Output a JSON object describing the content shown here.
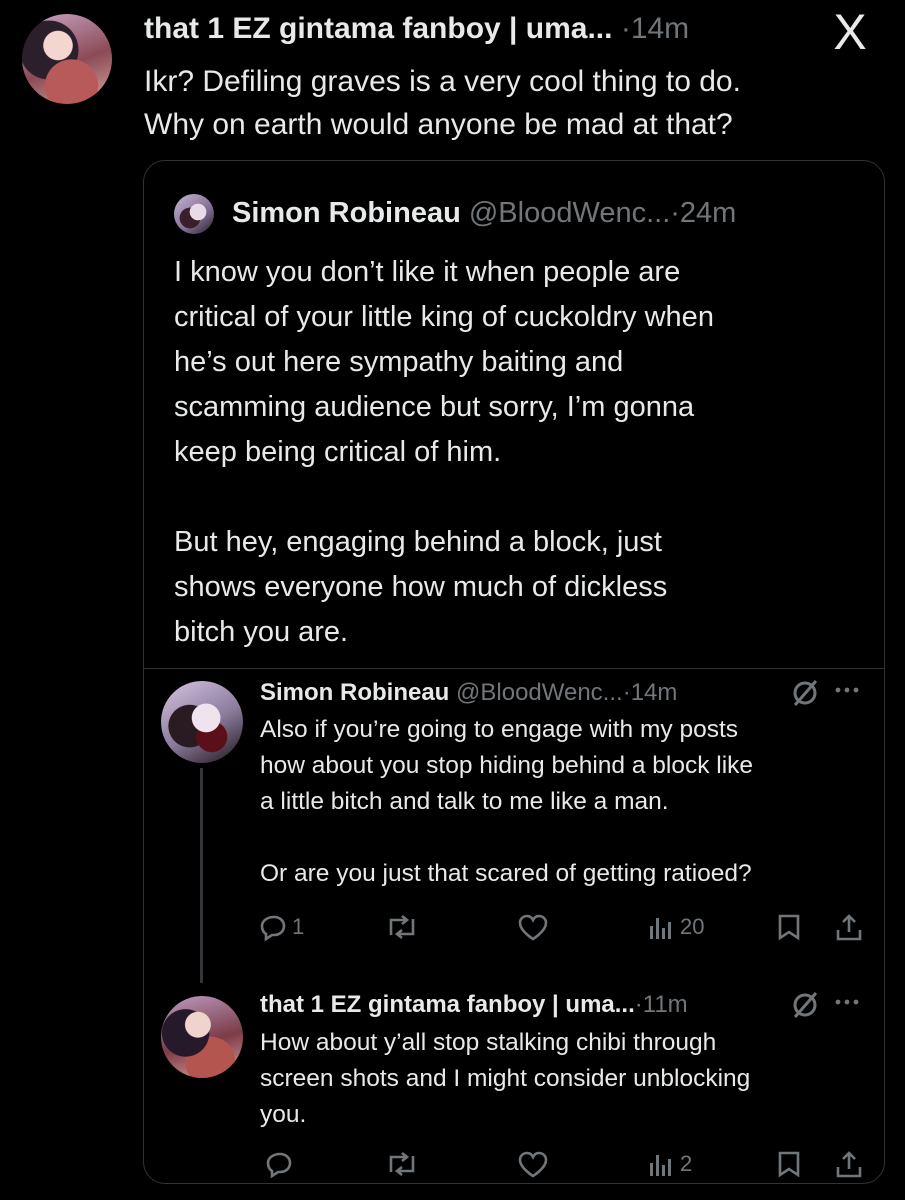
{
  "main_tweet": {
    "display_name": "that 1 EZ gintama fanboy | uma...",
    "separator": "·",
    "time": "14m",
    "text": "Ikr? Defiling graves is a very cool thing to do.\nWhy on earth would anyone be mad at that?"
  },
  "close_label": "X",
  "quoted": {
    "display_name": "Simon Robineau",
    "handle": "@BloodWenc...",
    "separator": "·",
    "time": "24m",
    "text": "I know you don’t like it when people are\ncritical of your little king of cuckoldry when\nhe’s out here sympathy baiting and\nscamming audience but sorry, I’m gonna\nkeep being critical of him.\n\nBut hey, engaging behind a block, just\nshows everyone how much of dickless\nbitch you are."
  },
  "replies": [
    {
      "display_name": "Simon Robineau",
      "handle": "@BloodWenc...",
      "separator": "·",
      "time": "14m",
      "text": "Also if you’re going to engage with my posts\nhow about you stop hiding behind a block like\na little bitch and talk to me like a man.\n\nOr are you just that scared of getting ratioed?",
      "reply_count": "1",
      "view_count": "20"
    },
    {
      "display_name": "that 1 EZ gintama fanboy | uma...",
      "separator": "·",
      "time": "11m",
      "text": "How about y’all stop stalking chibi through\nscreen shots and I might consider unblocking\nyou.",
      "view_count": "2"
    }
  ],
  "icons": [
    "close-icon",
    "grok-icon",
    "more-icon",
    "reply-icon",
    "repost-icon",
    "like-icon",
    "views-icon",
    "bookmark-icon",
    "share-icon"
  ]
}
